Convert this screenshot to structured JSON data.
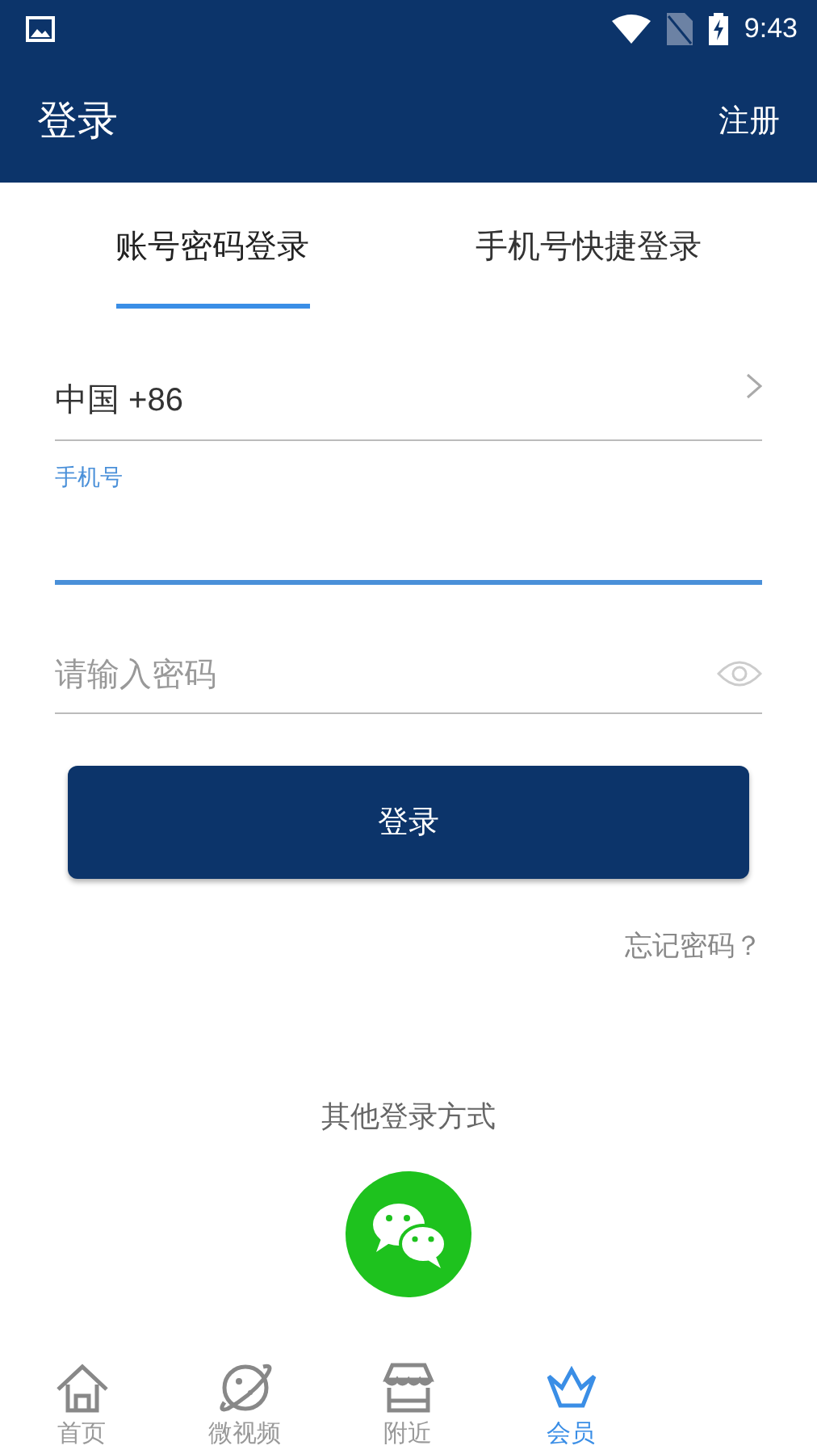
{
  "status_bar": {
    "time": "9:43"
  },
  "app_bar": {
    "title": "登录",
    "action": "注册"
  },
  "tabs": [
    {
      "label": "账号密码登录",
      "selected": true
    },
    {
      "label": "手机号快捷登录",
      "selected": false
    }
  ],
  "country": {
    "value": "中国 +86"
  },
  "phone": {
    "label": "手机号",
    "focused": true
  },
  "password": {
    "placeholder": "请输入密码"
  },
  "login_button": "登录",
  "forgot": "忘记密码？",
  "other_login": {
    "title": "其他登录方式"
  },
  "nav": [
    {
      "label": "首页",
      "selected": false
    },
    {
      "label": "微视频",
      "selected": false
    },
    {
      "label": "附近",
      "selected": false
    },
    {
      "label": "会员",
      "selected": true
    }
  ]
}
